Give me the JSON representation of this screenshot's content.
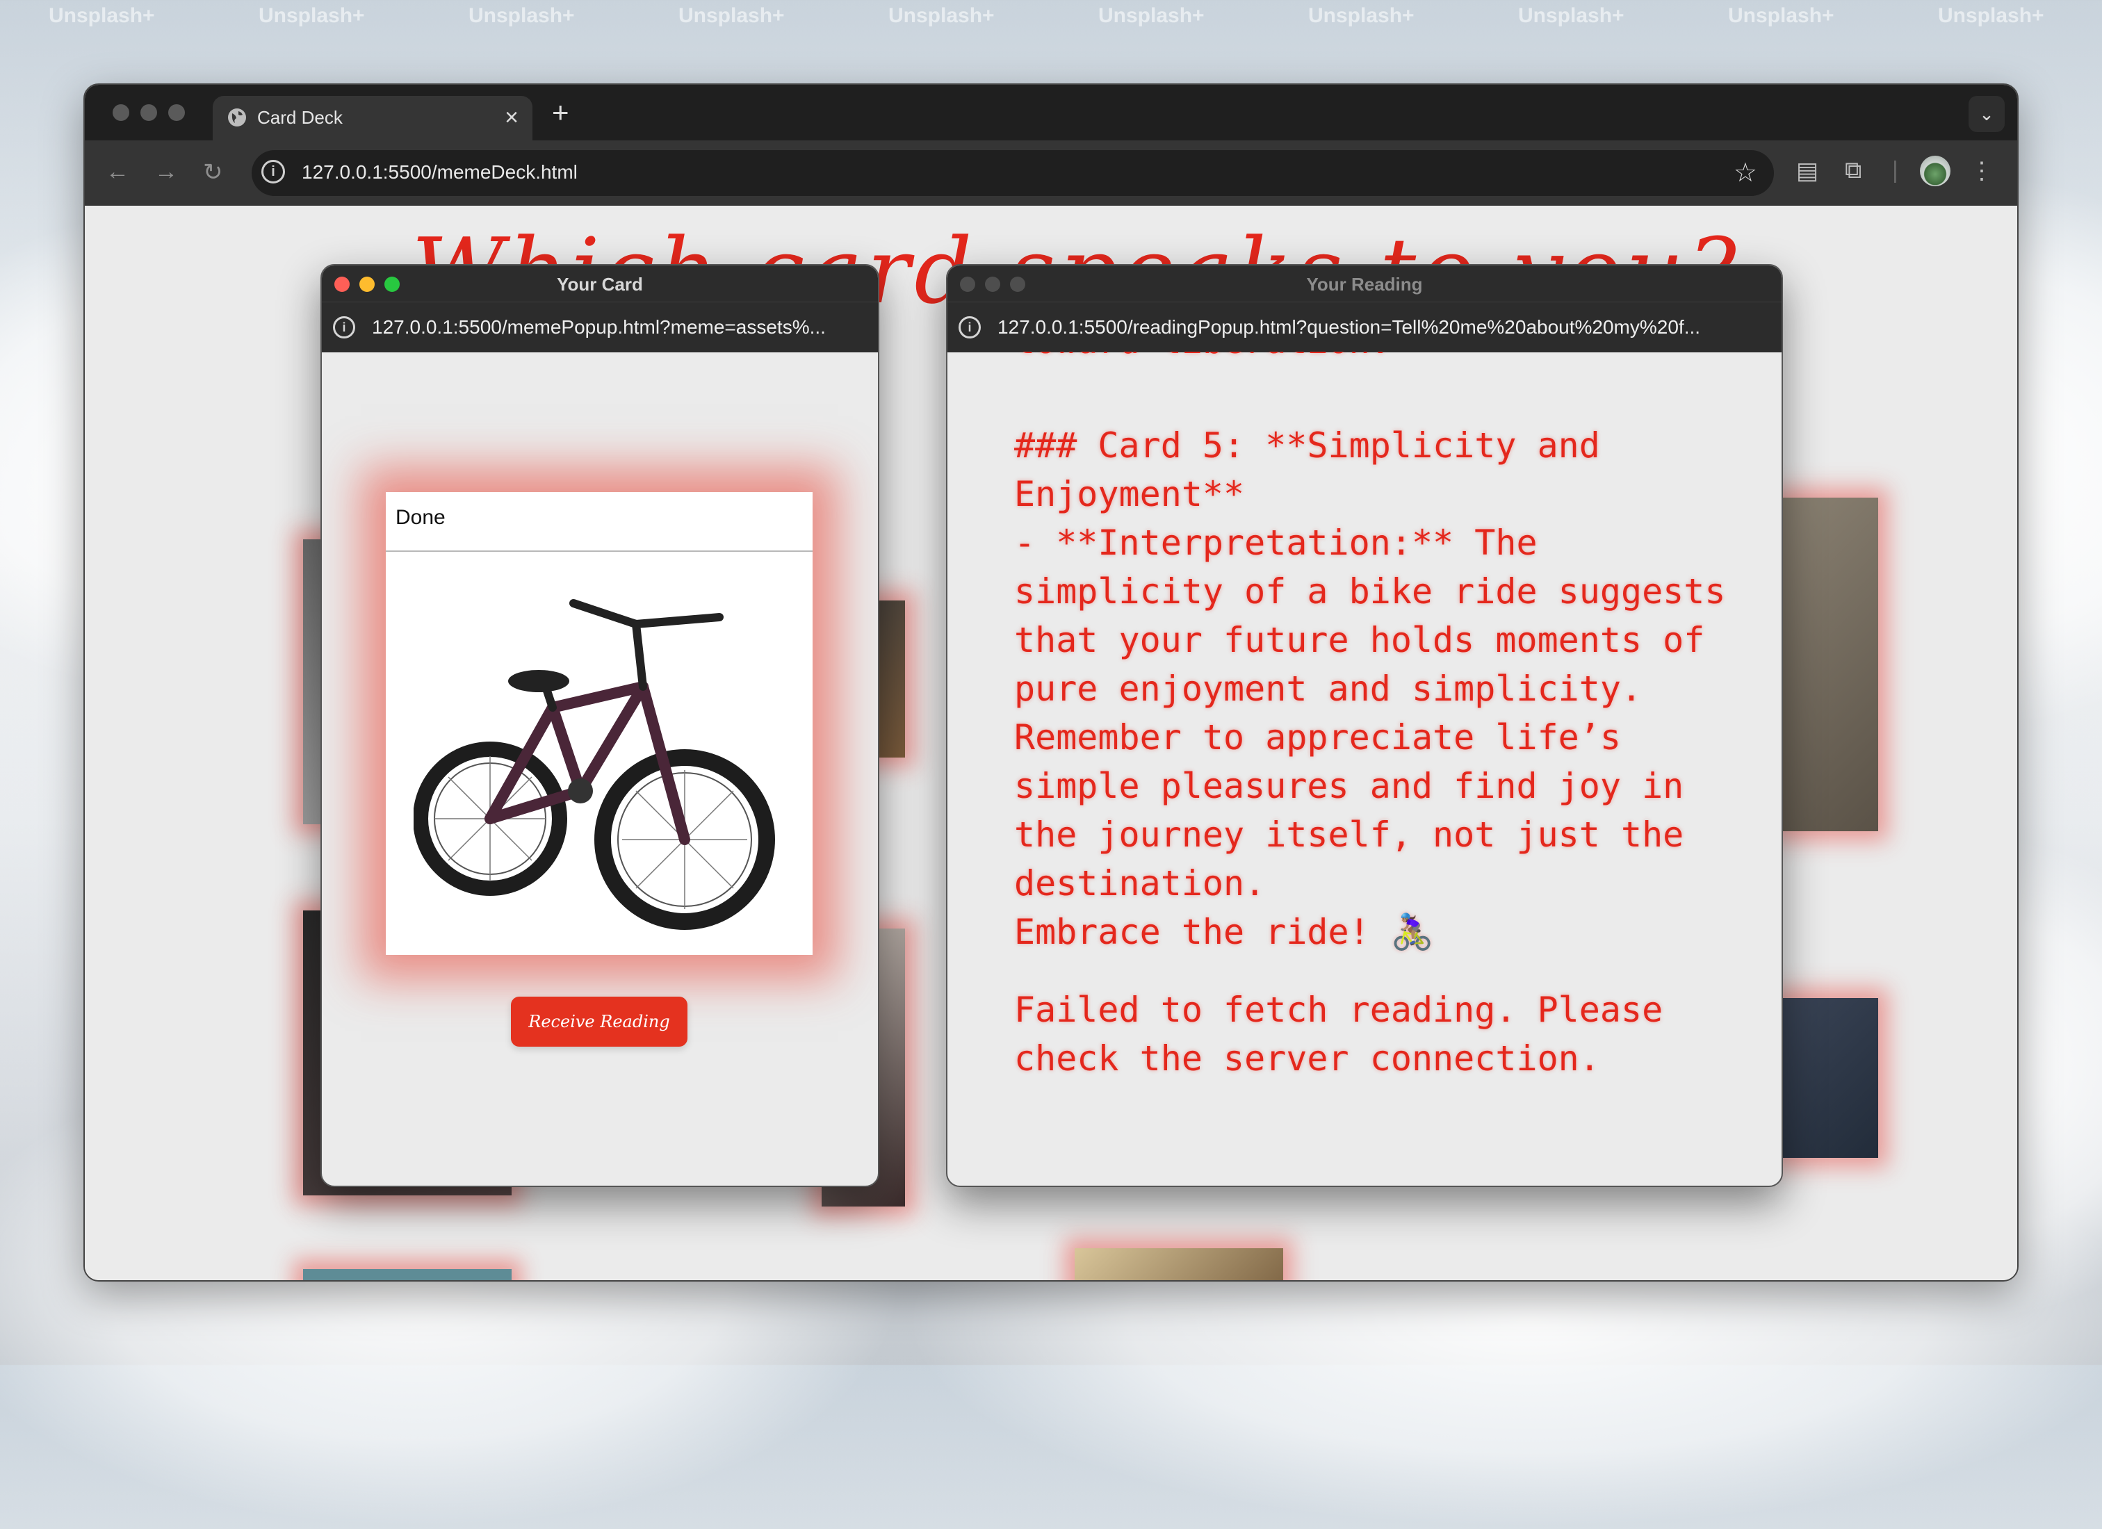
{
  "desktop": {
    "watermark": "Unsplash+"
  },
  "browser": {
    "tab_title": "Card Deck",
    "new_tab": "+",
    "tab_close": "×",
    "url": "127.0.0.1:5500/memeDeck.html",
    "page_heading": "Which card speaks to you?"
  },
  "card_popup": {
    "title": "Your Card",
    "url": "127.0.0.1:5500/memePopup.html?meme=assets%...",
    "card_caption": "Done",
    "button_label": "Receive Reading"
  },
  "reading_popup": {
    "title": "Your Reading",
    "url": "127.0.0.1:5500/readingPopup.html?question=Tell%20me%20about%20my%20f...",
    "partial_line": "toward liberation.",
    "card_heading": "### Card 5: **Simplicity and Enjoyment**",
    "interpretation": "- **Interpretation:** The simplicity of a bike ride suggests that your future holds moments of pure enjoyment and simplicity. Remember to appreciate life’s simple pleasures and find joy in the journey itself, not just the destination.",
    "closing": "Embrace the ride! 🚴🏽‍♀️",
    "error": "Failed to fetch reading. Please check the server connection."
  },
  "colors": {
    "accent": "#e4271c",
    "button": "#e4321f"
  }
}
